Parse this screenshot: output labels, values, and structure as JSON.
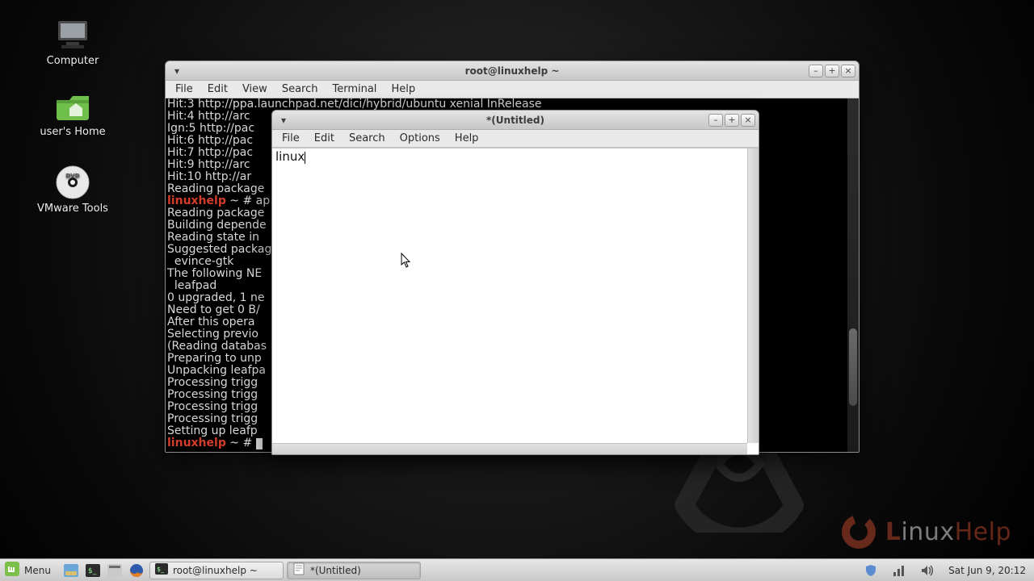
{
  "desktop": {
    "icons": {
      "computer": "Computer",
      "home": "user's Home",
      "vmware": "VMware Tools"
    }
  },
  "watermark": {
    "brand_plain": "inux",
    "brand_bold": "L",
    "brand_tail": "Help"
  },
  "terminal": {
    "title": "root@linuxhelp ~",
    "menus": [
      "File",
      "Edit",
      "View",
      "Search",
      "Terminal",
      "Help"
    ],
    "lines": [
      {
        "t": "Hit:3 http://ppa.launchpad.net/dici/hybrid/ubuntu xenial InRelease"
      },
      {
        "t": "Hit:4 http://arc"
      },
      {
        "t": "Ign:5 http://pac"
      },
      {
        "t": "Hit:6 http://pac"
      },
      {
        "t": "Hit:7 http://pac"
      },
      {
        "t": "Hit:9 http://arc"
      },
      {
        "t": "Hit:10 http://ar"
      },
      {
        "t": "Reading package "
      },
      {
        "p": "linuxhelp",
        "s": " ~ # ap"
      },
      {
        "t": "Reading package "
      },
      {
        "t": "Building depende"
      },
      {
        "t": "Reading state in"
      },
      {
        "t": "Suggested packag"
      },
      {
        "t": "  evince-gtk"
      },
      {
        "t": "The following NE"
      },
      {
        "t": "  leafpad"
      },
      {
        "t": "0 upgraded, 1 ne"
      },
      {
        "t": "Need to get 0 B/"
      },
      {
        "t": "After this opera"
      },
      {
        "t": "Selecting previo"
      },
      {
        "t": "(Reading databas"
      },
      {
        "t": "Preparing to unp"
      },
      {
        "t": "Unpacking leafpa"
      },
      {
        "t": "Processing trigg"
      },
      {
        "t": "Processing trigg"
      },
      {
        "t": "Processing trigg"
      },
      {
        "t": "Processing trigg"
      },
      {
        "t": "Setting up leafp"
      },
      {
        "p": "linuxhelp",
        "s": " ~ # ",
        "cursor": true
      }
    ]
  },
  "leafpad": {
    "title": "*(Untitled)",
    "menus": [
      "File",
      "Edit",
      "Search",
      "Options",
      "Help"
    ],
    "text": "linux"
  },
  "panel": {
    "menu_label": "Menu",
    "tasks": [
      {
        "label": "root@linuxhelp ~",
        "active": false,
        "icon": "terminal"
      },
      {
        "label": "*(Untitled)",
        "active": true,
        "icon": "leafpad"
      }
    ],
    "clock": "Sat Jun 9, 20:12"
  }
}
